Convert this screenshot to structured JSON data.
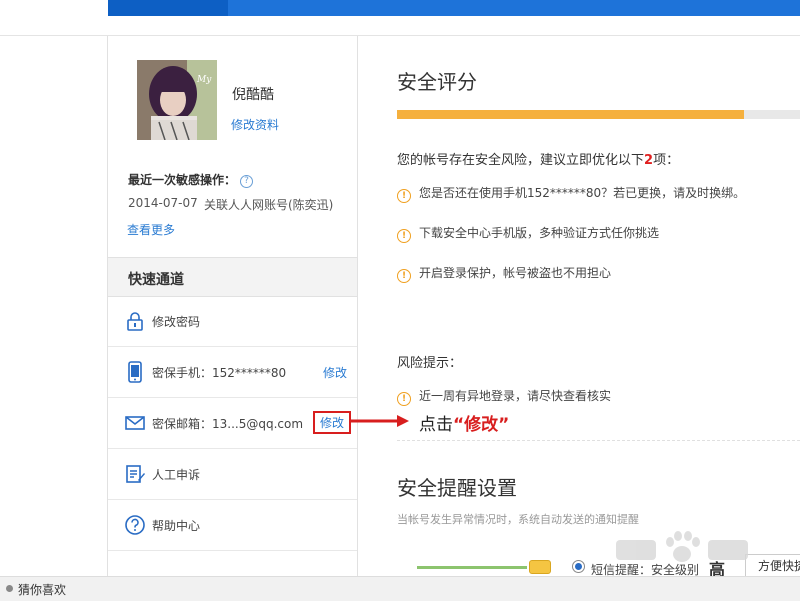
{
  "user": {
    "name": "倪酷酷",
    "edit_profile": "修改资料",
    "avatar_text": "My"
  },
  "recent": {
    "label": "最近一次敏感操作：",
    "date": "2014-07-07",
    "desc": "关联人人网账号(陈奕迅)",
    "see_more": "查看更多"
  },
  "quick": {
    "title": "快速通道",
    "items": [
      {
        "label": "修改密码",
        "icon": "lock-icon",
        "action": ""
      },
      {
        "label": "密保手机：152******80",
        "icon": "mobile-phone-icon",
        "action": "修改"
      },
      {
        "label": "密保邮箱：13...5@qq.com",
        "icon": "envelope-icon",
        "action": "修改"
      },
      {
        "label": "人工申诉",
        "icon": "document-edit-icon",
        "action": ""
      },
      {
        "label": "帮助中心",
        "icon": "help-circle-icon",
        "action": ""
      }
    ]
  },
  "security_score": {
    "title": "安全评分",
    "progress_pct": 86
  },
  "risk": {
    "prefix": "您的帐号存在安全风险，建议立即优化以下",
    "count": "2",
    "suffix": "项：",
    "tips": [
      "您是否还在使用手机152******80？若已更换，请及时换绑。",
      "下载安全中心手机版，多种验证方式任你挑选",
      "开启登录保护，帐号被盗也不用担心"
    ],
    "hint_title": "风险提示：",
    "hint_items": [
      "近一周有异地登录，请尽快查看核实"
    ]
  },
  "annotation": {
    "text": "点击",
    "quote": "“修改”"
  },
  "alert_settings": {
    "title": "安全提醒设置",
    "subtitle": "当帐号发生异常情况时，系统自动发送的通知提醒",
    "sms_label": "短信提醒：安全级别",
    "level_mark": "高",
    "convenient": "方便快捷"
  },
  "bottom": {
    "guess": "猜你喜欢"
  },
  "colors": {
    "accent": "#1e73d9",
    "link": "#2a7bd2",
    "progress": "#f5b03e",
    "annotation_red": "#d81e1e"
  }
}
